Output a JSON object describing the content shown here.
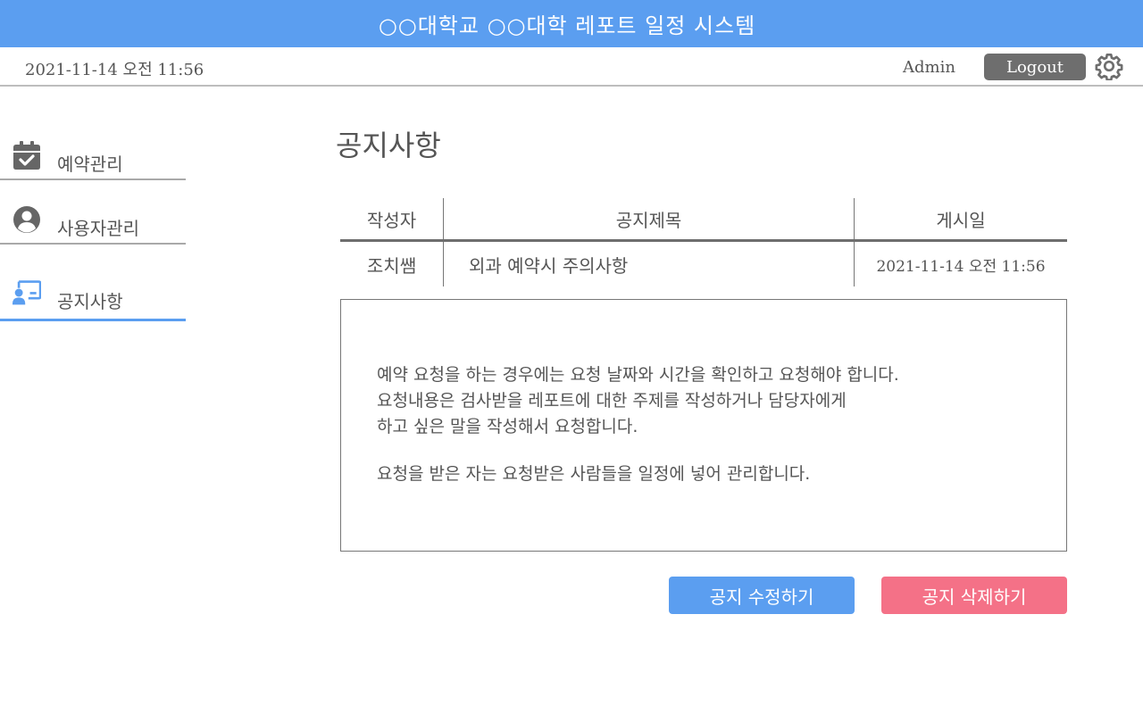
{
  "header": {
    "title": "○○대학교 ○○대학 레포트 일정 시스템"
  },
  "subbar": {
    "datetime": "2021-11-14 오전 11:56",
    "user": "Admin",
    "logout_label": "Logout",
    "settings_icon": "gear-icon"
  },
  "sidebar": {
    "items": [
      {
        "label": "예약관리",
        "icon": "calendar-check-icon",
        "active": false
      },
      {
        "label": "사용자관리",
        "icon": "user-circle-icon",
        "active": false
      },
      {
        "label": "공지사항",
        "icon": "presentation-icon",
        "active": true
      }
    ]
  },
  "main": {
    "title": "공지사항",
    "table": {
      "headers": [
        "작성자",
        "공지제목",
        "게시일"
      ],
      "row": {
        "author": "조치쌤",
        "subject": "외과 예약시 주의사항",
        "date": "2021-11-14 오전 11:56"
      }
    },
    "content": {
      "lines": [
        "예약 요청을 하는 경우에는 요청 날짜와 시간을 확인하고 요청해야 합니다.",
        "요청내용은 검사받을 레포트에 대한 주제를 작성하거나 담당자에게",
        "하고 싶은 말을 작성해서 요청합니다.",
        "요청을 받은 자는 요청받은 사람들을 일정에 넣어 관리합니다."
      ]
    },
    "buttons": {
      "edit_label": "공지 수정하기",
      "delete_label": "공지 삭제하기"
    }
  },
  "colors": {
    "accent": "#5b9ef0",
    "danger": "#f47187",
    "muted": "#6e6e6e"
  }
}
